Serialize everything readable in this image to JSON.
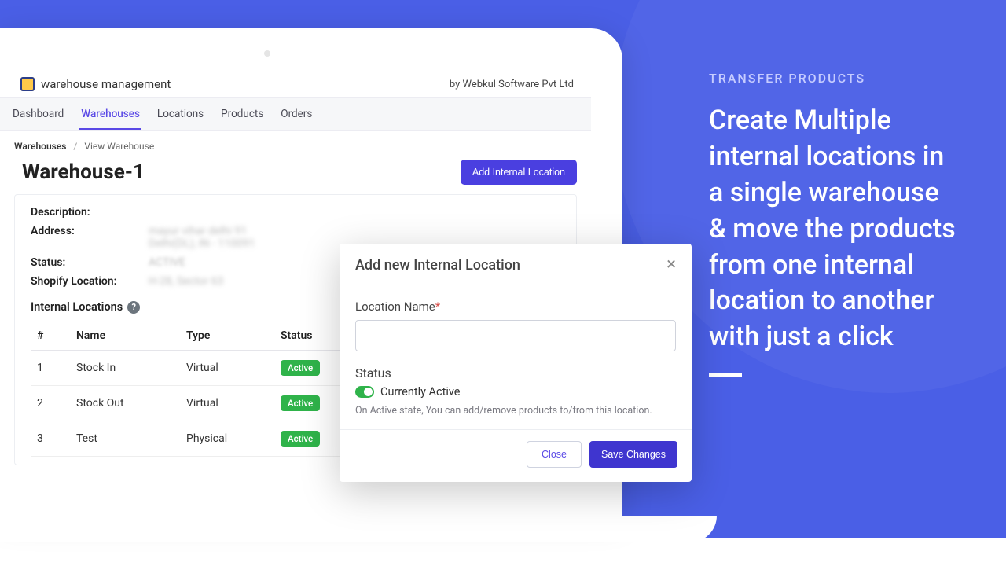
{
  "app": {
    "title": "warehouse management",
    "vendor": "by Webkul Software Pvt Ltd"
  },
  "nav": {
    "items": [
      "Dashboard",
      "Warehouses",
      "Locations",
      "Products",
      "Orders"
    ],
    "active_index": 1
  },
  "breadcrumb": {
    "root": "Warehouses",
    "current": "View Warehouse"
  },
  "page": {
    "title": "Warehouse-1",
    "add_button": "Add Internal Location"
  },
  "details": {
    "labels": {
      "description": "Description:",
      "address": "Address:",
      "status": "Status:",
      "shopify": "Shopify Location:"
    },
    "values": {
      "description": "",
      "address_line1": "mayur vihar delhi 91",
      "address_line2": "Delhi(DL), IN - 110091",
      "status": "ACTIVE",
      "shopify": "H-28, Sector 63"
    }
  },
  "internal_locations": {
    "title": "Internal Locations",
    "columns": [
      "#",
      "Name",
      "Type",
      "Status"
    ],
    "rows": [
      {
        "n": "1",
        "name": "Stock In",
        "type": "Virtual",
        "status": "Active"
      },
      {
        "n": "2",
        "name": "Stock Out",
        "type": "Virtual",
        "status": "Active"
      },
      {
        "n": "3",
        "name": "Test",
        "type": "Physical",
        "status": "Active"
      }
    ]
  },
  "modal": {
    "title": "Add new Internal Location",
    "location_label": "Location Name",
    "status_label": "Status",
    "toggle_text": "Currently Active",
    "hint": "On Active state, You can add/remove products to/from this location.",
    "close": "Close",
    "save": "Save Changes"
  },
  "marketing": {
    "eyebrow": "TRANSFER PRODUCTS",
    "headline": "Create Multiple internal locations in a single warehouse & move the products from one internal location to another with just a click"
  }
}
